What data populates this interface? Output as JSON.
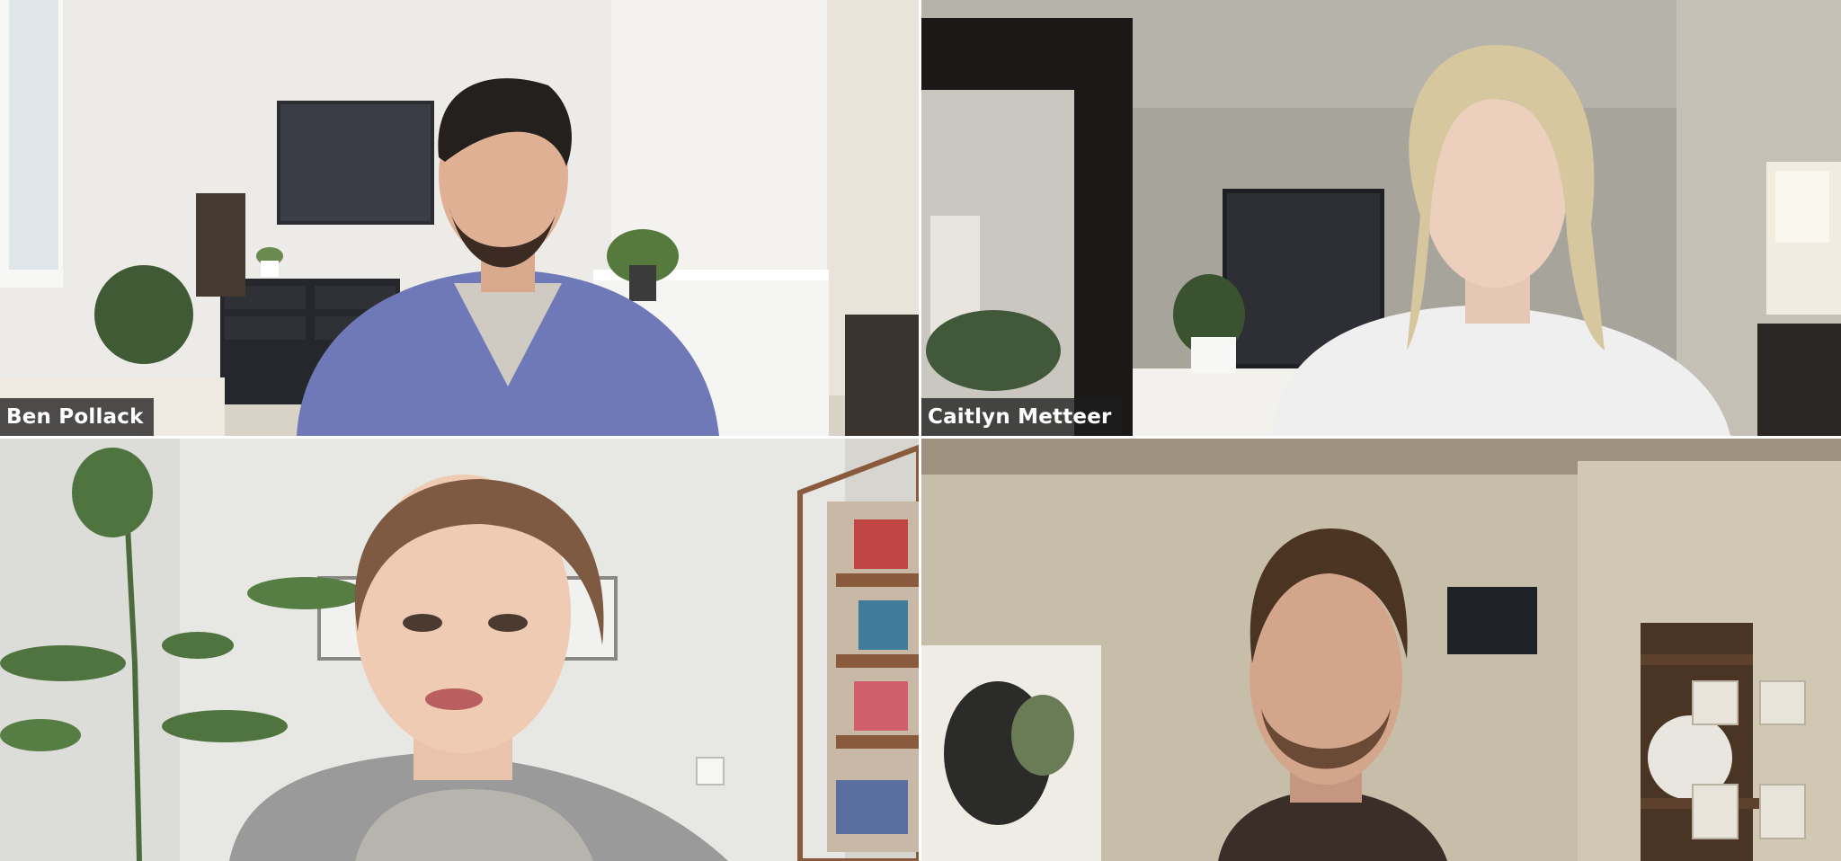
{
  "participants": [
    {
      "name": "Ben Pollack",
      "accent": "#6f79b8"
    },
    {
      "name": "Caitlyn Metteer",
      "accent": "#efefef"
    },
    {
      "name": "",
      "accent": "#9a9a9a"
    },
    {
      "name": "",
      "accent": "#3a2e28"
    }
  ],
  "colors": {
    "gap": "#ffffff",
    "name_tag_bg": "#1e1e1e",
    "name_tag_text": "#ffffff"
  }
}
